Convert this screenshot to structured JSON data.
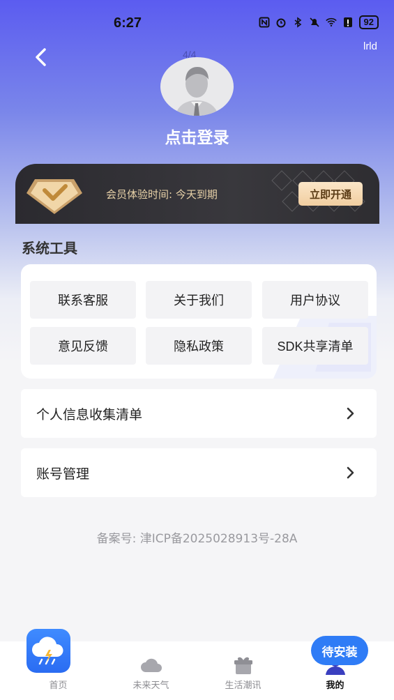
{
  "status_bar": {
    "time": "6:27",
    "battery": "92"
  },
  "header": {
    "language_label": "lrld",
    "page_indicator": "4/4",
    "login_text": "点击登录"
  },
  "vip": {
    "text": "会员体验时间: 今天到期",
    "button_label": "立即开通"
  },
  "tools": {
    "title": "系统工具",
    "items": [
      {
        "label": "联系客服"
      },
      {
        "label": "关于我们"
      },
      {
        "label": "用户协议"
      },
      {
        "label": "意见反馈"
      },
      {
        "label": "隐私政策"
      },
      {
        "label": "SDK共享清单"
      }
    ]
  },
  "list": [
    {
      "label": "个人信息收集清单"
    },
    {
      "label": "账号管理"
    }
  ],
  "icp": "备案号: 津ICP备2025028913号-28A",
  "bottom_nav": {
    "items": [
      {
        "label": "首页",
        "icon": "rain-cloud-icon"
      },
      {
        "label": "未来天气",
        "icon": "cloud-icon"
      },
      {
        "label": "生活潮讯",
        "icon": "gift-box-icon"
      },
      {
        "label": "我的",
        "icon": "person-icon"
      }
    ],
    "active_index": 3
  },
  "install_button": "待安装",
  "colors": {
    "accent": "#2f7cf6",
    "vip_gold": "#e8d2a8",
    "header_purple": "#5b5cf0"
  }
}
